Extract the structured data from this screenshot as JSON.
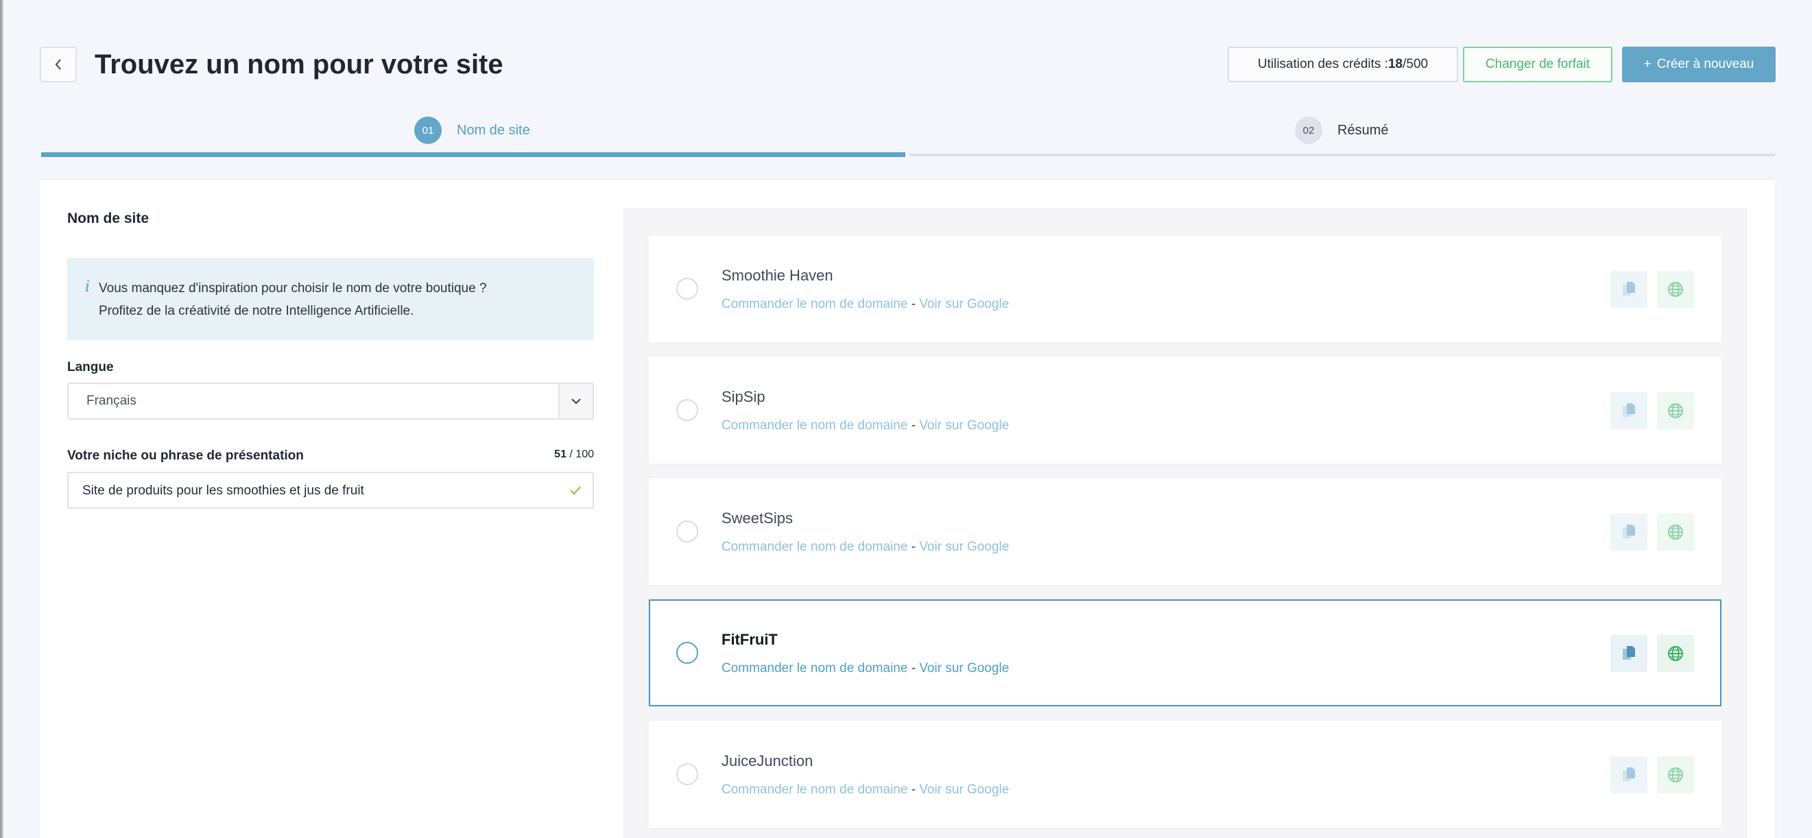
{
  "header": {
    "back_icon": "chevron-left-icon",
    "title": "Trouvez un nom pour votre site",
    "credits_label": "Utilisation des crédits : ",
    "credits_used": "18",
    "credits_total": "/500",
    "change_plan_label": "Changer de forfait",
    "create_again_plus": "+",
    "create_again_label": "Créer à nouveau"
  },
  "stepper": {
    "steps": [
      {
        "number": "01",
        "label": "Nom de site",
        "active": true
      },
      {
        "number": "02",
        "label": "Résumé",
        "active": false
      }
    ]
  },
  "form": {
    "section_title": "Nom de site",
    "info_line1": "Vous manquez d'inspiration pour choisir le nom de votre boutique ?",
    "info_line2": "Profitez de la créativité de notre Intelligence Artificielle.",
    "language_label": "Langue",
    "language_value": "Français",
    "niche_label": "Votre niche ou phrase de présentation",
    "char_count_current": "51",
    "char_count_max": " / 100",
    "niche_value": "Site de produits pour les smoothies et jus de fruit"
  },
  "suggestions": {
    "order_domain_label": "Commander le nom de domaine",
    "separator": " - ",
    "google_label": "Voir sur Google",
    "items": [
      {
        "name": "Smoothie Haven",
        "selected": false
      },
      {
        "name": "SipSip",
        "selected": false
      },
      {
        "name": "SweetSips",
        "selected": false
      },
      {
        "name": "FitFruiT",
        "selected": true
      },
      {
        "name": "JuiceJunction",
        "selected": false
      }
    ]
  },
  "colors": {
    "accent": "#63a6c8",
    "success": "#46b76b",
    "background": "#f5f6fc"
  }
}
